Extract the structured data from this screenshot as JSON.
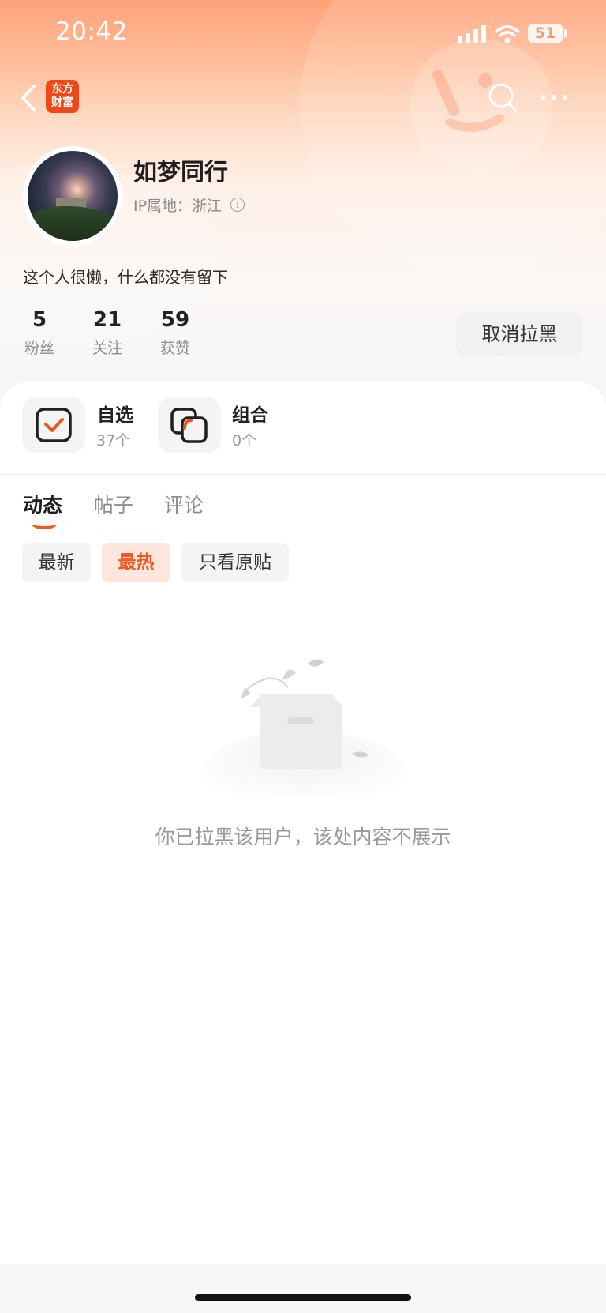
{
  "status_bar": {
    "time": "20:42",
    "battery": "51"
  },
  "header": {
    "logo_line1": "东方",
    "logo_line2": "财富"
  },
  "profile": {
    "name": "如梦同行",
    "ip_location": "IP属地：浙江",
    "bio": "这个人很懒，什么都没有留下",
    "stats": [
      {
        "value": "5",
        "label": "粉丝"
      },
      {
        "value": "21",
        "label": "关注"
      },
      {
        "value": "59",
        "label": "获赞"
      }
    ],
    "unblock_label": "取消拉黑"
  },
  "features": [
    {
      "title": "自选",
      "count": "37个",
      "icon": "watchlist-check-icon"
    },
    {
      "title": "组合",
      "count": "0个",
      "icon": "portfolio-icon"
    }
  ],
  "tabs": [
    {
      "label": "动态",
      "active": true
    },
    {
      "label": "帖子",
      "active": false
    },
    {
      "label": "评论",
      "active": false
    }
  ],
  "filters": [
    {
      "label": "最新",
      "active": false
    },
    {
      "label": "最热",
      "active": true
    },
    {
      "label": "只看原贴",
      "active": false
    }
  ],
  "empty_state": {
    "message": "你已拉黑该用户，该处内容不展示"
  },
  "colors": {
    "accent": "#f0541f",
    "logo_bg": "#f0471b",
    "hero_top": "#ffa278"
  }
}
